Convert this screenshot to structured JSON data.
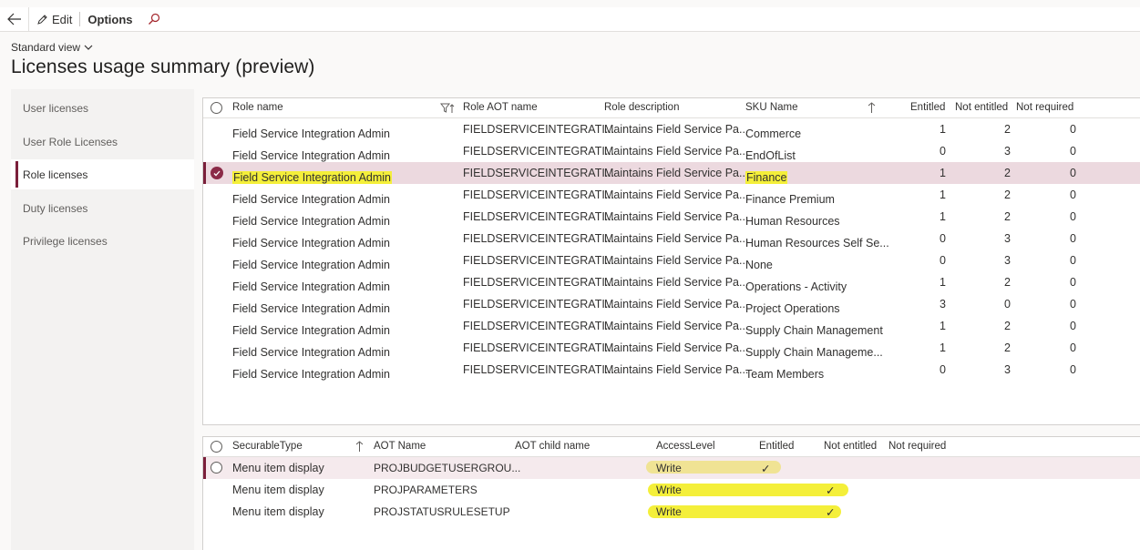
{
  "toolbar": {
    "edit_label": "Edit",
    "options_label": "Options"
  },
  "view": {
    "label": "Standard view"
  },
  "page": {
    "title": "Licenses usage summary (preview)"
  },
  "nav": {
    "items": [
      {
        "label": "User licenses"
      },
      {
        "label": "User Role Licenses"
      },
      {
        "label": "Role licenses"
      },
      {
        "label": "Duty licenses"
      },
      {
        "label": "Privilege licenses"
      }
    ]
  },
  "roles_grid": {
    "headers": {
      "role_name": "Role name",
      "aot_name": "Role AOT name",
      "description": "Role description",
      "sku": "SKU Name",
      "entitled": "Entitled",
      "not_entitled": "Not entitled",
      "not_required": "Not required"
    },
    "rows": [
      {
        "role": "Field Service Integration Admin",
        "aot": "FIELDSERVICEINTEGRATI...",
        "desc": "Maintains Field Service Pa...",
        "sku": "Commerce",
        "ent": "1",
        "not_ent": "2",
        "not_req": "0"
      },
      {
        "role": "Field Service Integration Admin",
        "aot": "FIELDSERVICEINTEGRATI...",
        "desc": "Maintains Field Service Pa...",
        "sku": "EndOfList",
        "ent": "0",
        "not_ent": "3",
        "not_req": "0"
      },
      {
        "role": "Field Service Integration Admin",
        "aot": "FIELDSERVICEINTEGRATI...",
        "desc": "Maintains Field Service Pa...",
        "sku": "Finance",
        "ent": "1",
        "not_ent": "2",
        "not_req": "0"
      },
      {
        "role": "Field Service Integration Admin",
        "aot": "FIELDSERVICEINTEGRATI...",
        "desc": "Maintains Field Service Pa...",
        "sku": "Finance Premium",
        "ent": "1",
        "not_ent": "2",
        "not_req": "0"
      },
      {
        "role": "Field Service Integration Admin",
        "aot": "FIELDSERVICEINTEGRATI...",
        "desc": "Maintains Field Service Pa...",
        "sku": "Human Resources",
        "ent": "1",
        "not_ent": "2",
        "not_req": "0"
      },
      {
        "role": "Field Service Integration Admin",
        "aot": "FIELDSERVICEINTEGRATI...",
        "desc": "Maintains Field Service Pa...",
        "sku": "Human Resources Self Se...",
        "ent": "0",
        "not_ent": "3",
        "not_req": "0"
      },
      {
        "role": "Field Service Integration Admin",
        "aot": "FIELDSERVICEINTEGRATI...",
        "desc": "Maintains Field Service Pa...",
        "sku": "None",
        "ent": "0",
        "not_ent": "3",
        "not_req": "0"
      },
      {
        "role": "Field Service Integration Admin",
        "aot": "FIELDSERVICEINTEGRATI...",
        "desc": "Maintains Field Service Pa...",
        "sku": "Operations - Activity",
        "ent": "1",
        "not_ent": "2",
        "not_req": "0"
      },
      {
        "role": "Field Service Integration Admin",
        "aot": "FIELDSERVICEINTEGRATI...",
        "desc": "Maintains Field Service Pa...",
        "sku": "Project Operations",
        "ent": "3",
        "not_ent": "0",
        "not_req": "0"
      },
      {
        "role": "Field Service Integration Admin",
        "aot": "FIELDSERVICEINTEGRATI...",
        "desc": "Maintains Field Service Pa...",
        "sku": "Supply Chain Management",
        "ent": "1",
        "not_ent": "2",
        "not_req": "0"
      },
      {
        "role": "Field Service Integration Admin",
        "aot": "FIELDSERVICEINTEGRATI...",
        "desc": "Maintains Field Service Pa...",
        "sku": "Supply Chain Manageme...",
        "ent": "1",
        "not_ent": "2",
        "not_req": "0"
      },
      {
        "role": "Field Service Integration Admin",
        "aot": "FIELDSERVICEINTEGRATI...",
        "desc": "Maintains Field Service Pa...",
        "sku": "Team Members",
        "ent": "0",
        "not_ent": "3",
        "not_req": "0"
      }
    ]
  },
  "securables_grid": {
    "headers": {
      "type": "SecurableType",
      "aot_name": "AOT Name",
      "aot_child": "AOT child name",
      "access": "AccessLevel",
      "entitled": "Entitled",
      "not_entitled": "Not entitled",
      "not_required": "Not required"
    },
    "rows": [
      {
        "type": "Menu item display",
        "aot": "PROJBUDGETUSERGROU...",
        "child": "",
        "access": "Write",
        "ent": "✓",
        "not_ent": "",
        "not_req": ""
      },
      {
        "type": "Menu item display",
        "aot": "PROJPARAMETERS",
        "child": "",
        "access": "Write",
        "ent": "",
        "not_ent": "✓",
        "not_req": ""
      },
      {
        "type": "Menu item display",
        "aot": "PROJSTATUSRULESETUP",
        "child": "",
        "access": "Write",
        "ent": "",
        "not_ent": "✓",
        "not_req": ""
      }
    ]
  },
  "colors": {
    "accent": "#7a1f3a",
    "selected_row": "#ecd9df",
    "highlight": "#f4ef3a"
  }
}
